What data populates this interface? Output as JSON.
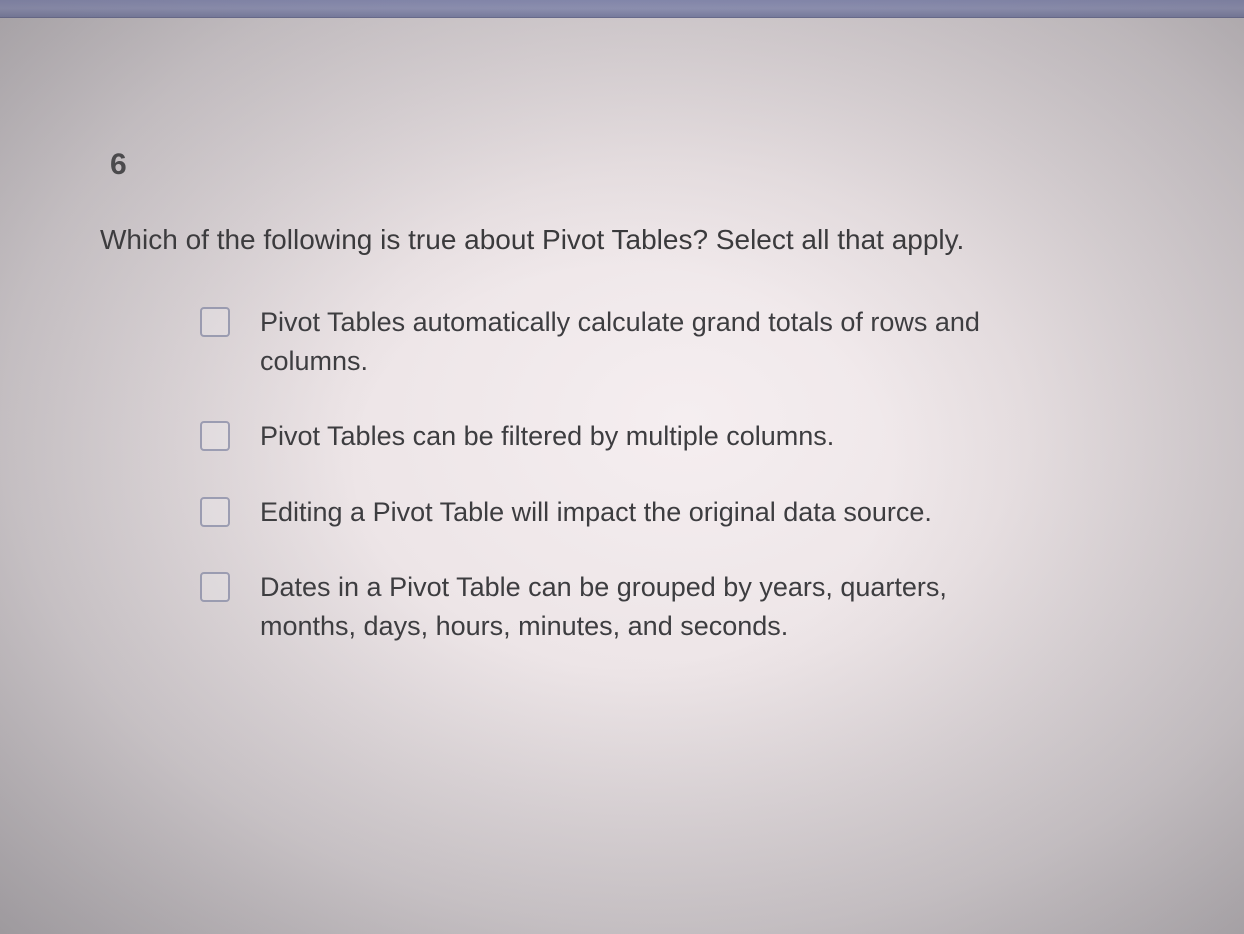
{
  "question": {
    "number": "6",
    "text": "Which of the following is true about Pivot Tables? Select all that apply.",
    "options": [
      {
        "label": "Pivot Tables automatically calculate grand totals of rows and columns.",
        "checked": false
      },
      {
        "label": "Pivot Tables can be filtered by multiple columns.",
        "checked": false
      },
      {
        "label": "Editing a Pivot Table will impact the original data source.",
        "checked": false
      },
      {
        "label": "Dates in a Pivot Table can be grouped by years, quarters, months, days, hours, minutes, and seconds.",
        "checked": false
      }
    ]
  }
}
